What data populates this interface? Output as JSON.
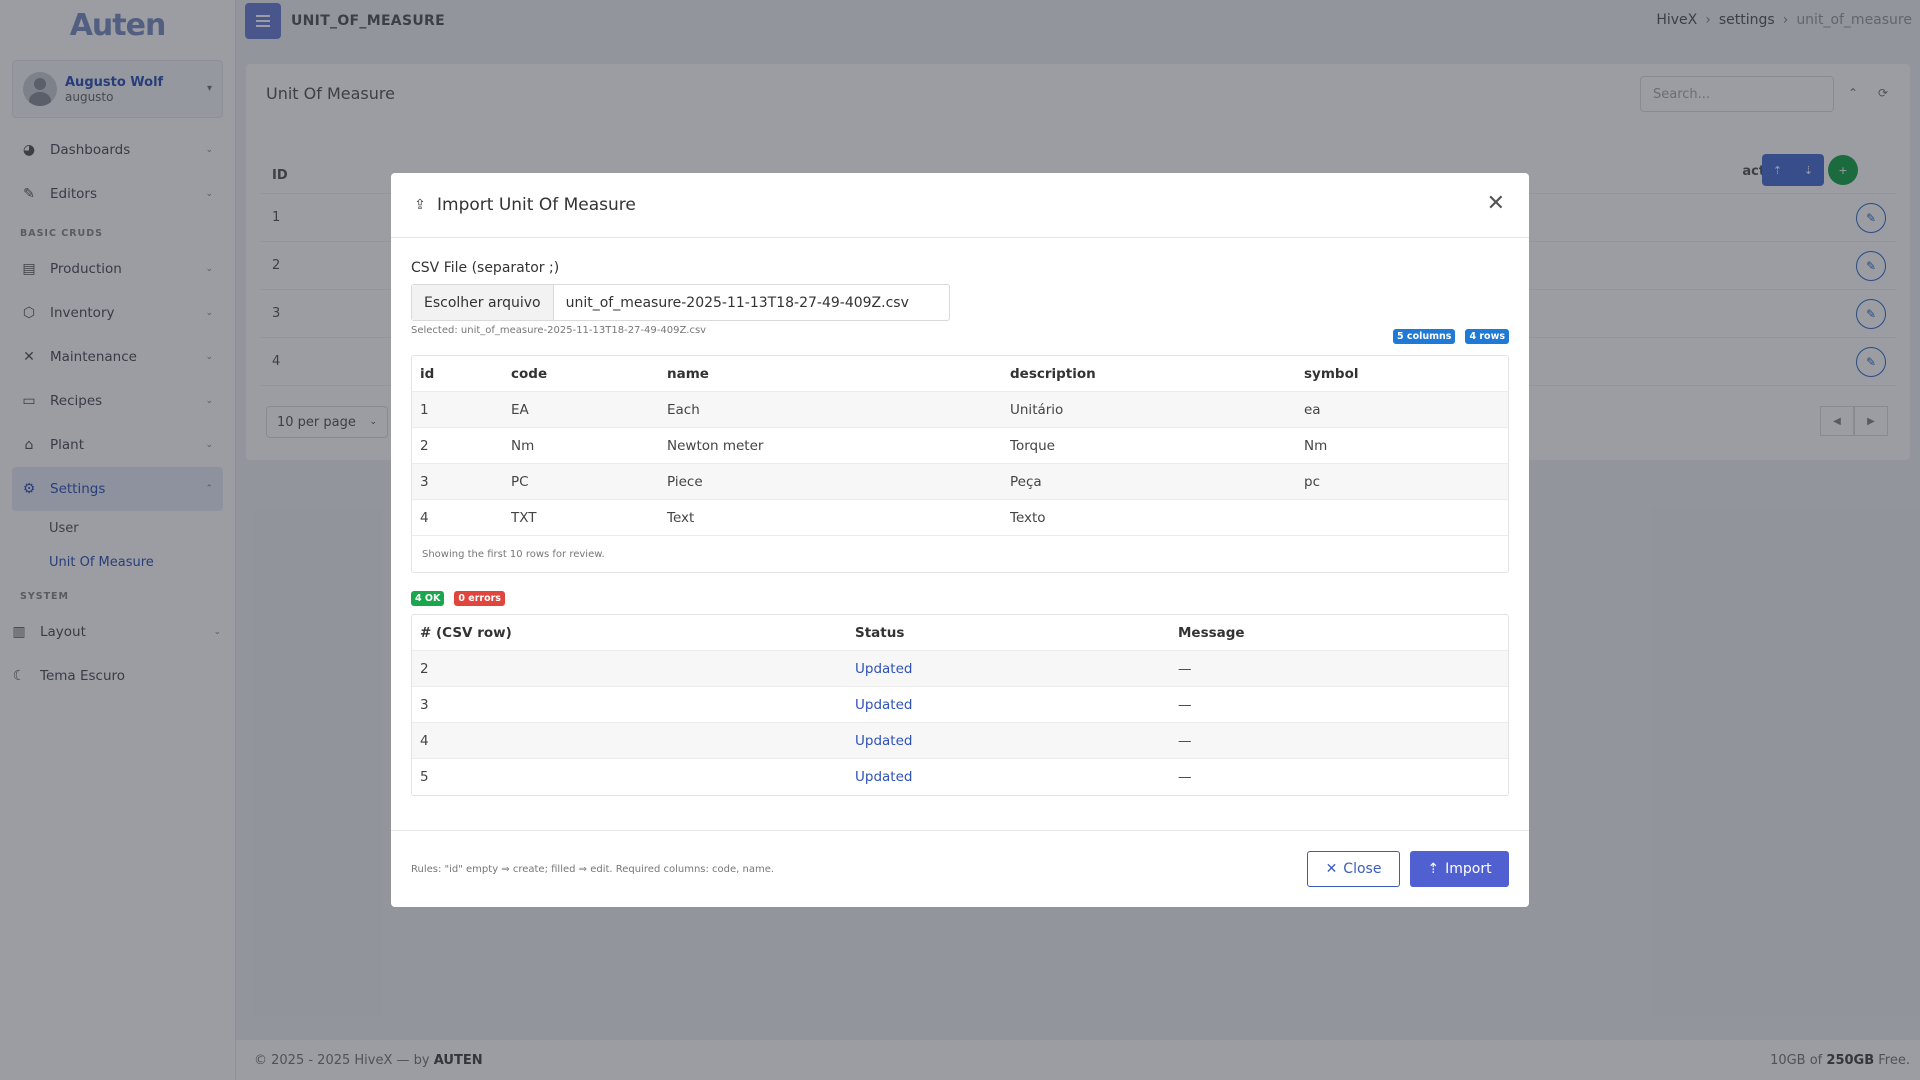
{
  "app": {
    "logo": "Auten",
    "brand_color": "#6b7fd6"
  },
  "user": {
    "name": "Augusto Wolf",
    "login": "augusto"
  },
  "sidebar": {
    "items": [
      {
        "label": "Dashboards",
        "icon": "dashboard-icon"
      },
      {
        "label": "Editors",
        "icon": "edit-icon"
      }
    ],
    "section_basic": "BASIC CRUDS",
    "crud_items": [
      {
        "label": "Production",
        "icon": "clipboard-icon"
      },
      {
        "label": "Inventory",
        "icon": "box-icon"
      },
      {
        "label": "Maintenance",
        "icon": "tools-icon"
      },
      {
        "label": "Recipes",
        "icon": "book-icon"
      },
      {
        "label": "Plant",
        "icon": "factory-icon"
      },
      {
        "label": "Settings",
        "icon": "gear-icon"
      }
    ],
    "settings_sub": [
      "User",
      "Unit Of Measure"
    ],
    "section_system": "SYSTEM",
    "system_items": [
      {
        "label": "Layout",
        "icon": "layout-icon"
      },
      {
        "label": "Tema Escuro",
        "icon": "moon-icon"
      }
    ]
  },
  "header": {
    "page_id": "UNIT_OF_MEASURE",
    "breadcrumb": [
      "HiveX",
      "settings",
      "unit_of_measure"
    ]
  },
  "page": {
    "title": "Unit Of Measure",
    "search_placeholder": "Search...",
    "table_head_id": "ID",
    "row_ids": [
      "1",
      "2",
      "3",
      "4"
    ],
    "act_label": "act.",
    "per_page": "10 per page"
  },
  "footer": {
    "left_prefix": "© 2025 - 2025 HiveX — by",
    "left_brand": "AUTEN",
    "right_prefix": "10GB of",
    "right_bold": "250GB",
    "right_suffix": "Free."
  },
  "modal": {
    "title": "Import Unit Of Measure",
    "file_label": "CSV File (separator ;)",
    "file_button": "Escolher arquivo",
    "file_name": "unit_of_measure-2025-11-13T18-27-49-409Z.csv",
    "selected_text": "Selected: unit_of_measure-2025-11-13T18-27-49-409Z.csv",
    "columns_badge": "5 columns",
    "rows_badge": "4 rows",
    "preview": {
      "headers": [
        "id",
        "code",
        "name",
        "description",
        "symbol"
      ],
      "rows": [
        [
          "1",
          "EA",
          "Each",
          "Unitário",
          "ea"
        ],
        [
          "2",
          "Nm",
          "Newton meter",
          "Torque",
          "Nm"
        ],
        [
          "3",
          "PC",
          "Piece",
          "Peça",
          "pc"
        ],
        [
          "4",
          "TXT",
          "Text",
          "Texto",
          ""
        ]
      ],
      "note": "Showing the first 10 rows for review."
    },
    "ok_badge": "4 OK",
    "error_badge": "0 errors",
    "results": {
      "headers": [
        "# (CSV row)",
        "Status",
        "Message"
      ],
      "rows": [
        [
          "2",
          "Updated",
          "—"
        ],
        [
          "3",
          "Updated",
          "—"
        ],
        [
          "4",
          "Updated",
          "—"
        ],
        [
          "5",
          "Updated",
          "—"
        ]
      ]
    },
    "rules": "Rules: \"id\" empty ⇒ create; filled ⇒ edit. Required columns: code, name.",
    "close_label": "Close",
    "import_label": "Import"
  }
}
